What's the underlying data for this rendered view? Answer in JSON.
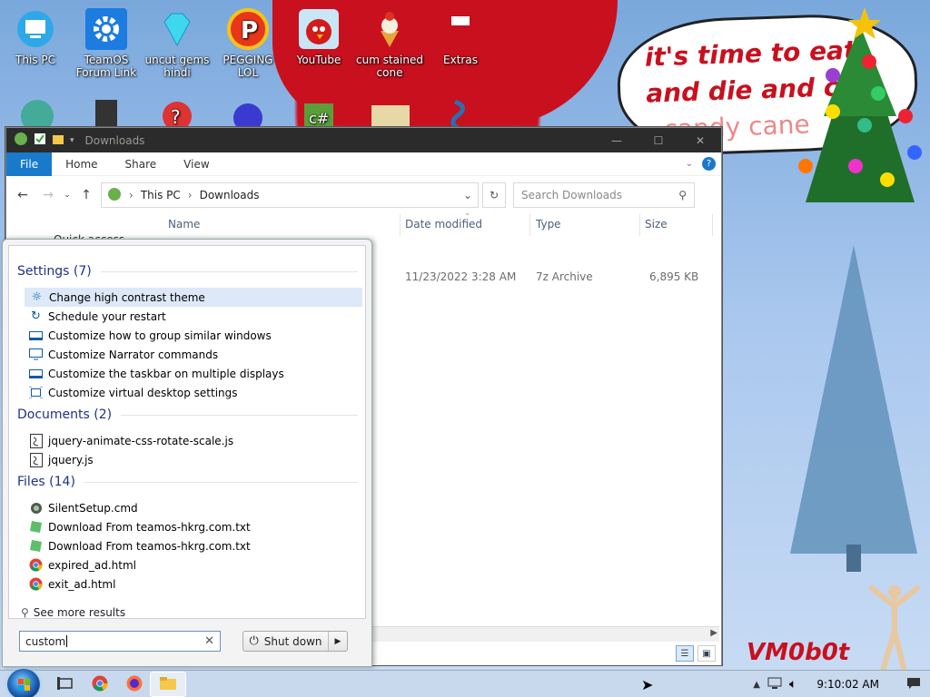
{
  "desktop": {
    "icons_row1": [
      {
        "label": "This PC",
        "icon": "this-pc-icon"
      },
      {
        "label": "TeamOS Forum Link",
        "icon": "gear-icon"
      },
      {
        "label": "uncut gems hindi",
        "icon": "diamond-icon"
      },
      {
        "label": "PEGGING LOL",
        "icon": "p-logo-icon"
      },
      {
        "label": "YouTube",
        "icon": "angry-bird-icon"
      },
      {
        "label": "cum stained cone",
        "icon": "ice-cream-icon"
      },
      {
        "label": "Extras",
        "icon": "book-icon"
      }
    ],
    "wallpaper_text": [
      "it's time to eat",
      "and die and cl",
      "candy cane"
    ],
    "watermark": "VM0b0t",
    "colors": {
      "hat": "#c8101e",
      "sky": "#a9c7ee"
    }
  },
  "explorer": {
    "title": "Downloads",
    "ribbon_tabs": [
      "File",
      "Home",
      "Share",
      "View"
    ],
    "breadcrumb": [
      "This PC",
      "Downloads"
    ],
    "search_placeholder": "Search Downloads",
    "columns": [
      "Name",
      "Date modified",
      "Type",
      "Size"
    ],
    "quick_access": "Quick access",
    "rows": [
      {
        "date": "11/23/2022 3:28 AM",
        "type": "7z Archive",
        "size": "6,895 KB"
      }
    ]
  },
  "start_search": {
    "groups": [
      {
        "title": "Settings (7)",
        "items": [
          {
            "label": "Change high contrast theme",
            "icon": "sun-icon",
            "selected": true
          },
          {
            "label": "Schedule your restart",
            "icon": "refresh-icon"
          },
          {
            "label": "Customize how to group similar windows",
            "icon": "taskbar-icon"
          },
          {
            "label": "Customize Narrator commands",
            "icon": "narrator-icon"
          },
          {
            "label": "Customize the taskbar on multiple displays",
            "icon": "taskbar-icon"
          },
          {
            "label": "Customize virtual desktop settings",
            "icon": "virtual-desktop-icon"
          }
        ]
      },
      {
        "title": "Documents (2)",
        "items": [
          {
            "label": "jquery-animate-css-rotate-scale.js",
            "icon": "script-file-icon"
          },
          {
            "label": "jquery.js",
            "icon": "script-file-icon"
          }
        ]
      },
      {
        "title": "Files (14)",
        "items": [
          {
            "label": "SilentSetup.cmd",
            "icon": "gear-file-icon"
          },
          {
            "label": "Download From teamos-hkrg.com.txt",
            "icon": "text-file-icon"
          },
          {
            "label": "Download From teamos-hkrg.com.txt",
            "icon": "text-file-icon"
          },
          {
            "label": "expired_ad.html",
            "icon": "chrome-icon"
          },
          {
            "label": "exit_ad.html",
            "icon": "chrome-icon"
          }
        ]
      }
    ],
    "see_more": "See more results",
    "query": "custom",
    "shutdown_label": "Shut down"
  },
  "taskbar": {
    "clock": "9:10:02 AM"
  }
}
